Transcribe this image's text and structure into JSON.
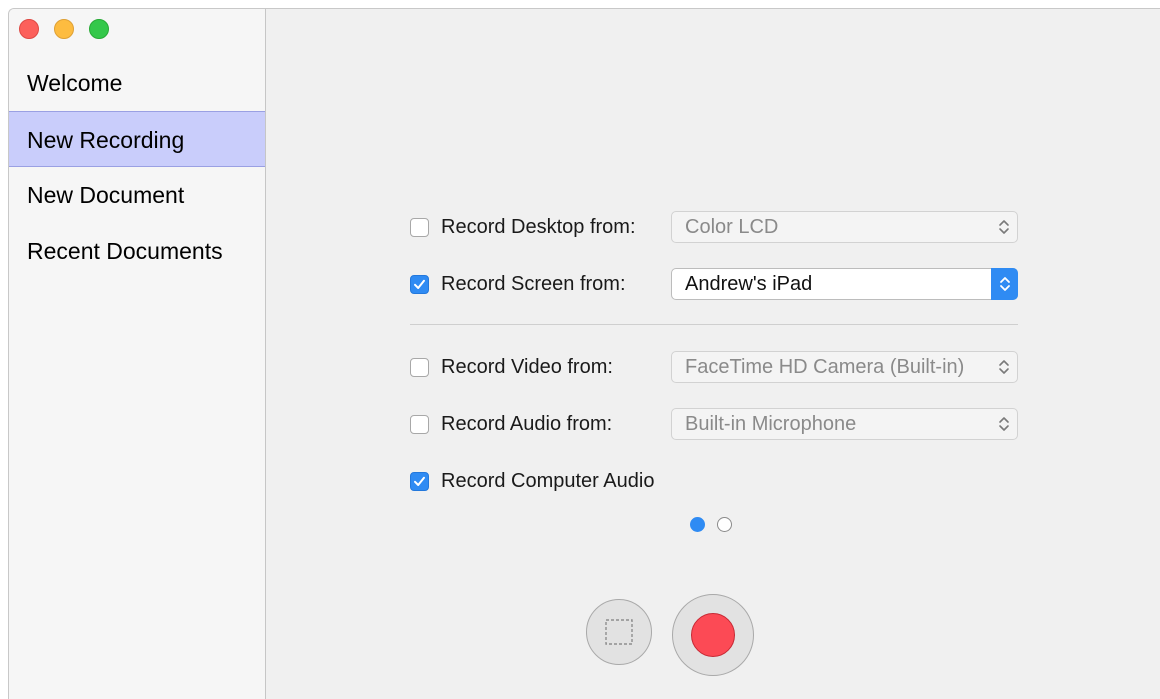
{
  "window": {
    "controls": [
      "close",
      "minimize",
      "zoom"
    ]
  },
  "sidebar": {
    "items": [
      {
        "label": "Welcome",
        "selected": false
      },
      {
        "label": "New Recording",
        "selected": true
      },
      {
        "label": "New Document",
        "selected": false
      },
      {
        "label": "Recent Documents",
        "selected": false
      }
    ]
  },
  "options": {
    "desktop": {
      "label": "Record Desktop from:",
      "checked": false,
      "source": "Color LCD"
    },
    "screen": {
      "label": "Record Screen from:",
      "checked": true,
      "source": "Andrew's iPad"
    },
    "video": {
      "label": "Record Video from:",
      "checked": false,
      "source": "FaceTime HD Camera (Built-in)"
    },
    "audio": {
      "label": "Record Audio from:",
      "checked": false,
      "source": "Built-in Microphone"
    },
    "computer_audio": {
      "label": "Record Computer Audio",
      "checked": true
    }
  },
  "pager": {
    "current": 1,
    "total": 2
  },
  "controls": {
    "area_icon": "dashed-selection-icon",
    "record_icon": "record-dot-icon"
  },
  "colors": {
    "accent": "#2f8bf3",
    "selection": "#c9cdfb",
    "record": "#fc4a55",
    "close": "#fc605b",
    "minimize": "#fdbc40",
    "zoom": "#34c84a"
  }
}
